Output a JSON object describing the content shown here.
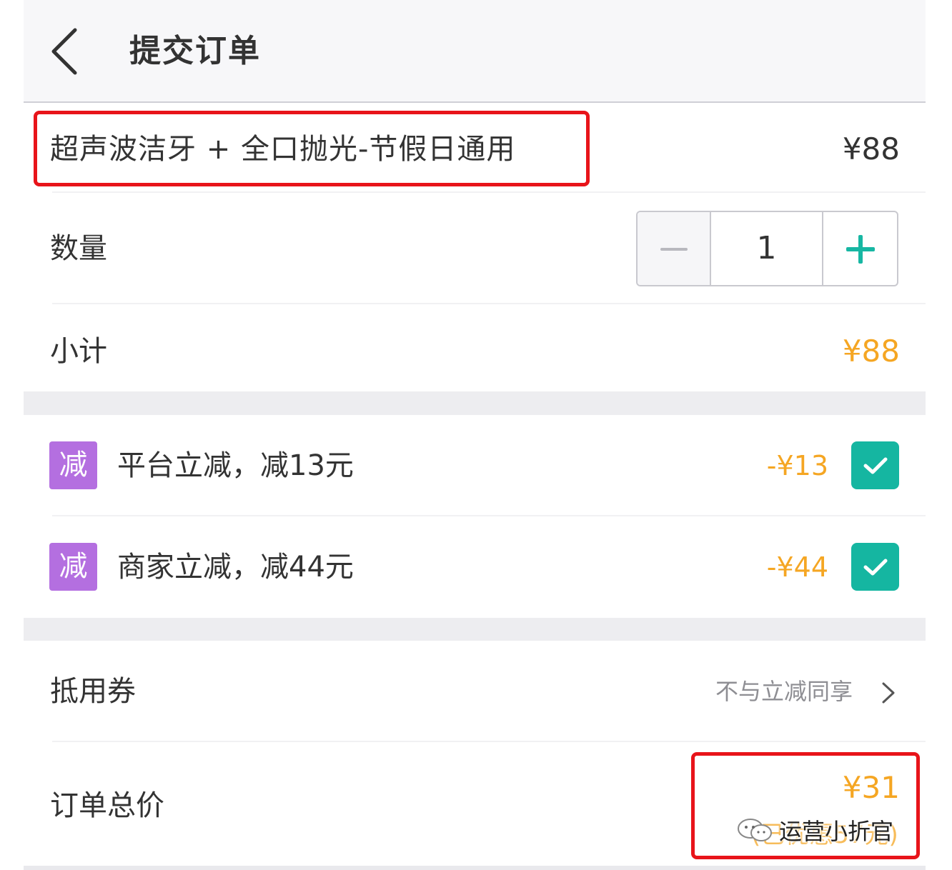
{
  "header": {
    "title": "提交订单"
  },
  "product": {
    "name": "超声波洁牙 + 全口抛光-节假日通用",
    "price": "¥88"
  },
  "quantity": {
    "label": "数量",
    "value": "1"
  },
  "subtotal": {
    "label": "小计",
    "value": "¥88"
  },
  "discounts": [
    {
      "badge": "减",
      "text": "平台立减，减13元",
      "amount": "-¥13",
      "checked": true
    },
    {
      "badge": "减",
      "text": "商家立减，减44元",
      "amount": "-¥44",
      "checked": true
    }
  ],
  "coupon": {
    "label": "抵用券",
    "hint": "不与立减同享"
  },
  "total": {
    "label": "订单总价",
    "value": "¥31",
    "note": "(已优惠57元)"
  },
  "watermark": {
    "text": "运营小折官"
  },
  "colors": {
    "accent": "#f5a623",
    "check": "#15b6a1",
    "badge": "#b46fe0",
    "highlight": "#e8141a"
  }
}
